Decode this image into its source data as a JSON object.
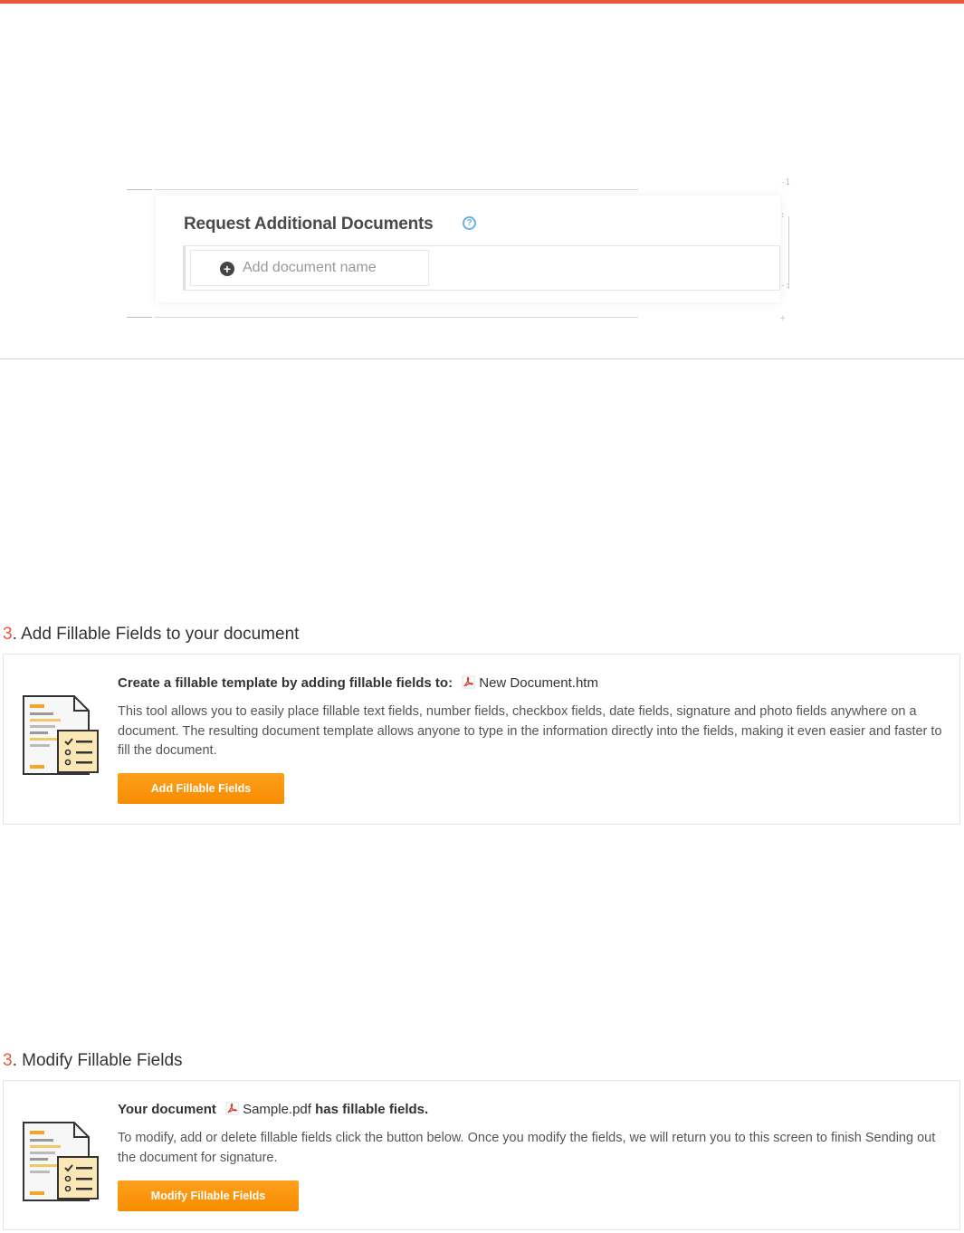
{
  "colors": {
    "accent": "#e8573f",
    "button": "#f7941d",
    "help": "#66b1e6"
  },
  "request_docs": {
    "title": "Request Additional Documents",
    "add_label": "Add document name",
    "help_icon": "question-circle-icon",
    "add_icon": "plus-circle-icon"
  },
  "add_section": {
    "number": "3",
    "heading": ". Add Fillable Fields to your document",
    "title_bold": "Create a fillable template by adding fillable fields to:",
    "file_name": "New Document.htm",
    "description": "This tool allows you to easily place fillable text fields, number fields, checkbox fields, date fields, signature and photo fields anywhere on a document. The resulting document template allows anyone to type in the information directly into the fields, making it even easier and faster to fill the document.",
    "button_label": "Add Fillable Fields",
    "illustration": "document-checklist-icon"
  },
  "modify_section": {
    "number": "3",
    "heading": ". Modify Fillable Fields",
    "title_prefix": "Your document",
    "file_name": "Sample.pdf",
    "title_suffix": "has fillable fields.",
    "description": "To modify, add or delete fillable fields click the button below. Once you modify the fields, we will return you to this screen to finish Sending out the document for signature.",
    "button_label": "Modify Fillable Fields",
    "illustration": "document-checklist-icon"
  }
}
